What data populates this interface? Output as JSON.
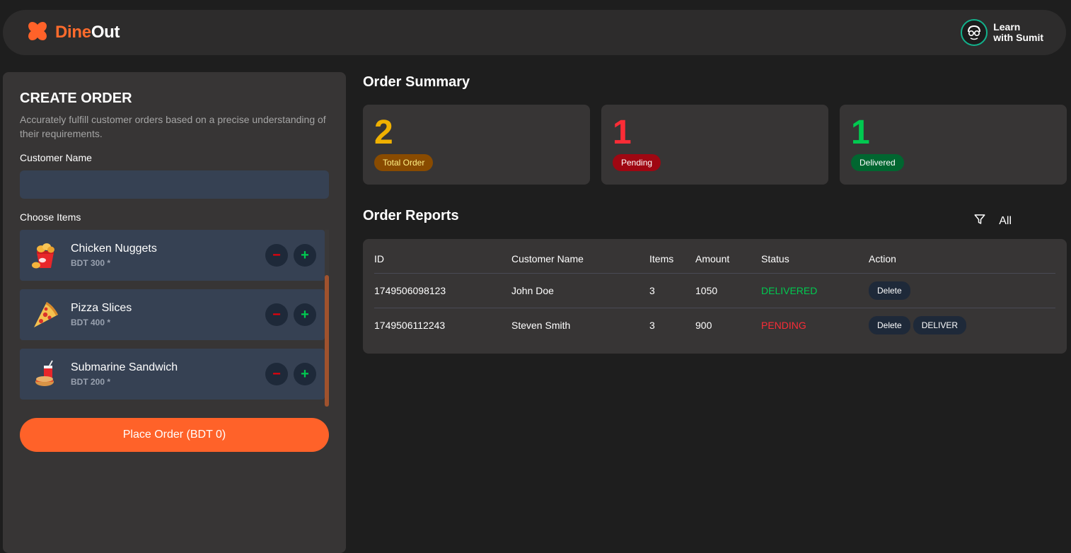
{
  "brand": {
    "part1": "Dine",
    "part2": "Out"
  },
  "lws": {
    "line1": "Learn",
    "line2": "with Sumit"
  },
  "create_order": {
    "title": "CREATE ORDER",
    "description": "Accurately fulfill customer orders based on a precise understanding of their requirements.",
    "customer_name_label": "Customer Name",
    "customer_name_value": "",
    "choose_items_label": "Choose Items",
    "items": [
      {
        "name": "Chicken Nuggets",
        "price": "BDT 300 *",
        "icon": "nuggets-icon"
      },
      {
        "name": "Pizza Slices",
        "price": "BDT 400 *",
        "icon": "pizza-icon"
      },
      {
        "name": "Submarine Sandwich",
        "price": "BDT 200 *",
        "icon": "sandwich-icon"
      }
    ],
    "place_order_label": "Place Order (BDT 0)"
  },
  "summary": {
    "title": "Order Summary",
    "cards": [
      {
        "value": "2",
        "label": "Total Order",
        "color": "#f0b100",
        "badge_bg": "#894b00",
        "badge_fg": "#fff085"
      },
      {
        "value": "1",
        "label": "Pending",
        "color": "#fb2c36",
        "badge_bg": "#9f0712",
        "badge_fg": "#ffffff"
      },
      {
        "value": "1",
        "label": "Delivered",
        "color": "#00c950",
        "badge_bg": "#016630",
        "badge_fg": "#ffffff"
      }
    ]
  },
  "reports": {
    "title": "Order Reports",
    "filter_label": "All",
    "columns": [
      "ID",
      "Customer Name",
      "Items",
      "Amount",
      "Status",
      "Action"
    ],
    "rows": [
      {
        "id": "1749506098123",
        "customer": "John Doe",
        "items": "3",
        "amount": "1050",
        "status": "DELIVERED",
        "actions": [
          "Delete"
        ]
      },
      {
        "id": "1749506112243",
        "customer": "Steven Smith",
        "items": "3",
        "amount": "900",
        "status": "PENDING",
        "actions": [
          "Delete",
          "DELIVER"
        ]
      }
    ]
  },
  "colors": {
    "accent": "#ff6229",
    "background": "#1e1e1e",
    "panel": "#373535",
    "item_bg": "#364153"
  }
}
